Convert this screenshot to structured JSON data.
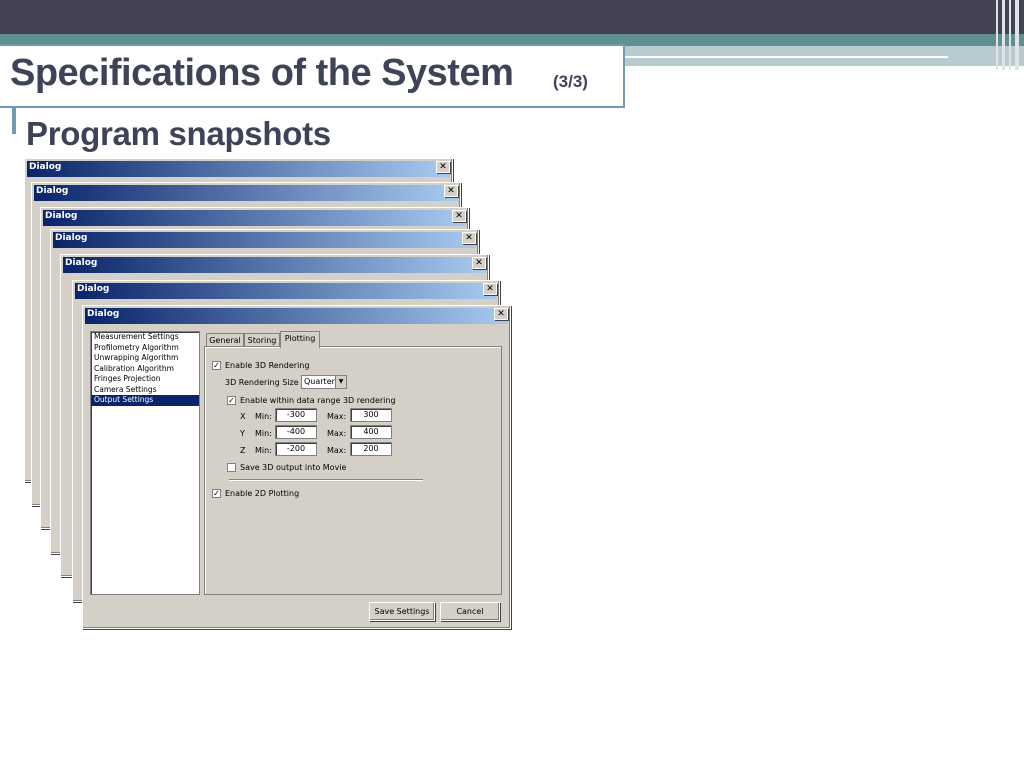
{
  "slide": {
    "title": "Specifications of the System",
    "title_suffix": "(3/3)",
    "subtitle": "Program snapshots"
  },
  "dialog": {
    "window_title": "Dialog",
    "close_glyph": "✕",
    "stacked_titles": [
      "Dialog",
      "Dialog",
      "Dialog",
      "Dialog",
      "Dialog",
      "Dialog"
    ],
    "settings_list": [
      "Measurement Settings",
      "Profilometry Algorithm",
      "Unwrapping Algorithm",
      "Calibration Algorithm",
      "Fringes Projection",
      "Camera Settings",
      "Output Settings"
    ],
    "selected_item": "Output Settings",
    "tabs": [
      "General",
      "Storing",
      "Plotting"
    ],
    "active_tab": "Plotting",
    "plotting": {
      "enable_3d_label": "Enable 3D Rendering",
      "enable_3d_checked": true,
      "rendering_size_label": "3D Rendering Size",
      "rendering_size_value": "Quarter",
      "enable_range_label": "Enable within data range 3D rendering",
      "enable_range_checked": true,
      "min_label": "Min:",
      "max_label": "Max:",
      "x_label": "X",
      "x_min": "-300",
      "x_max": "300",
      "y_label": "Y",
      "y_min": "-400",
      "y_max": "400",
      "z_label": "Z",
      "z_min": "-200",
      "z_max": "200",
      "save_movie_label": "Save 3D output into Movie",
      "save_movie_checked": false,
      "enable_2d_label": "Enable 2D Plotting",
      "enable_2d_checked": true
    },
    "save_button": "Save Settings",
    "cancel_button": "Cancel",
    "check_glyph": "✓"
  },
  "colors": {
    "title_text": "#3e4358",
    "top_band": "#434355",
    "teal_band": "#5f8f8e",
    "accent_border": "#6f9bb5",
    "dialog_face": "#d4d0c8",
    "titlebar_start": "#0a246a",
    "titlebar_end": "#a6caf0",
    "selection": "#0a246a"
  }
}
